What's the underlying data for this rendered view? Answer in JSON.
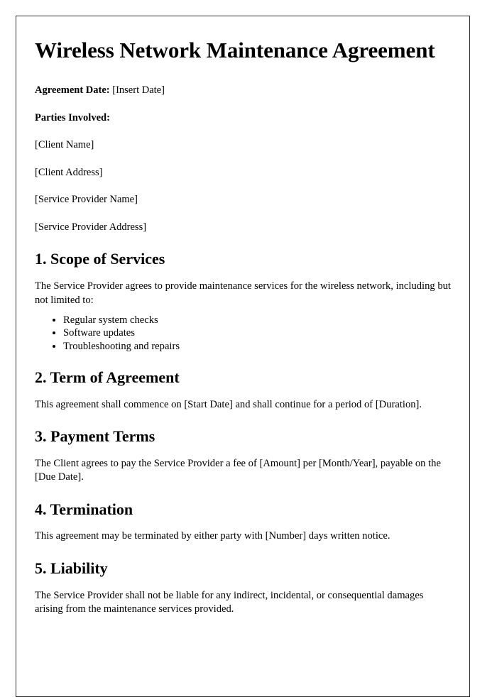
{
  "document": {
    "title": "Wireless Network Maintenance Agreement",
    "meta": {
      "agreement_date_label": "Agreement Date:",
      "agreement_date_value": "[Insert Date]",
      "parties_label": "Parties Involved:"
    },
    "parties": [
      "[Client Name]",
      "[Client Address]",
      "[Service Provider Name]",
      "[Service Provider Address]"
    ],
    "sections": [
      {
        "heading": "1. Scope of Services",
        "paragraph": "The Service Provider agrees to provide maintenance services for the wireless network, including but not limited to:",
        "bullets": [
          "Regular system checks",
          "Software updates",
          "Troubleshooting and repairs"
        ]
      },
      {
        "heading": "2. Term of Agreement",
        "paragraph": "This agreement shall commence on [Start Date] and shall continue for a period of [Duration]."
      },
      {
        "heading": "3. Payment Terms",
        "paragraph": "The Client agrees to pay the Service Provider a fee of [Amount] per [Month/Year], payable on the [Due Date]."
      },
      {
        "heading": "4. Termination",
        "paragraph": "This agreement may be terminated by either party with [Number] days written notice."
      },
      {
        "heading": "5. Liability",
        "paragraph": "The Service Provider shall not be liable for any indirect, incidental, or consequential damages arising from the maintenance services provided."
      }
    ],
    "colors": {
      "text": "#000000",
      "page_border": "#2b2b2b",
      "page_background": "#ffffff"
    }
  }
}
